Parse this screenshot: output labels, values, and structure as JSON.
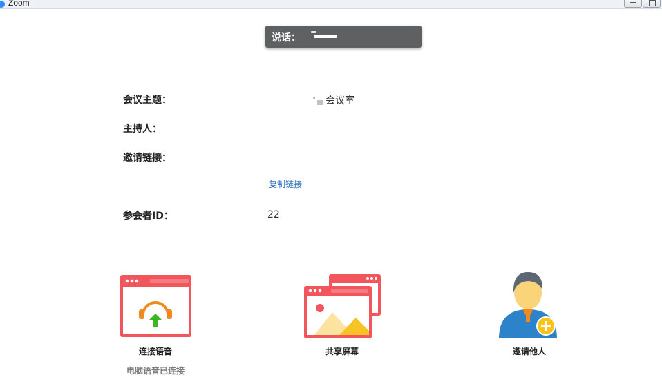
{
  "window": {
    "title": "Zoom"
  },
  "speaking": {
    "label": "说话："
  },
  "meeting": {
    "topic_label": "会议主题：",
    "topic_value": "会议室",
    "host_label": "主持人：",
    "invite_link_label": "邀请链接：",
    "copy_link": "复制链接",
    "participant_id_label": "参会者ID：",
    "participant_id_value": "22"
  },
  "actions": {
    "join_audio": "连接语音",
    "join_audio_status": "电脑语音已连接",
    "share_screen": "共享屏幕",
    "invite": "邀请他人"
  },
  "colors": {
    "tile_red": "#f2555b",
    "headset_orange": "#f08a1c",
    "arrow_green": "#3cb521",
    "mountain_yellow": "#f7c325",
    "person_blue": "#2d83c9",
    "person_hair": "#5d6773",
    "person_face": "#fad479",
    "plus_yellow": "#f8c41a",
    "link_blue": "#2d72c4"
  }
}
